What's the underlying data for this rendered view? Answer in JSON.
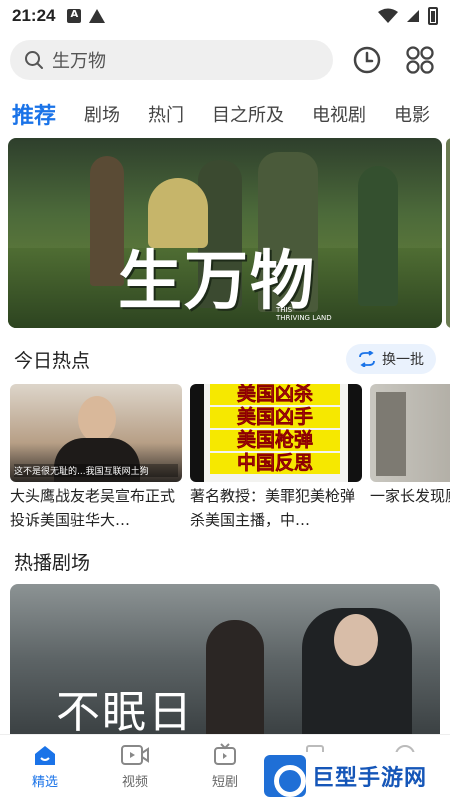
{
  "status_bar": {
    "time": "21:24"
  },
  "search": {
    "placeholder": "生万物"
  },
  "tabs": [
    {
      "label": "推荐",
      "active": true
    },
    {
      "label": "剧场"
    },
    {
      "label": "热门"
    },
    {
      "label": "目之所及"
    },
    {
      "label": "电视剧"
    },
    {
      "label": "电影"
    }
  ],
  "hero": {
    "title": "生万物",
    "subtitle_line1": "THIS",
    "subtitle_line2": "THRIVING LAND"
  },
  "today_hot": {
    "title": "今日热点",
    "refresh_label": "换一批",
    "items": [
      {
        "title": "大头鹰战友老吴宣布正式投诉美国驻华大…",
        "caption": "这不是很无耻的...我国互联网土狗"
      },
      {
        "title": "著名教授：美罪犯美枪弹杀美国主播，中…",
        "overlay": [
          "美国凶杀",
          "美国凶手",
          "美国枪弹",
          "中国反思"
        ]
      },
      {
        "title": "一家长发现厕所，洗…"
      }
    ]
  },
  "hot_drama": {
    "title": "热播剧场",
    "banner_title": "不眠日"
  },
  "bottom_nav": [
    {
      "label": "精选",
      "active": true
    },
    {
      "label": "视频"
    },
    {
      "label": "短剧"
    },
    {
      "label": ""
    },
    {
      "label": ""
    }
  ],
  "watermark": {
    "text": "巨型手游网"
  },
  "colors": {
    "accent": "#1a73e8"
  }
}
